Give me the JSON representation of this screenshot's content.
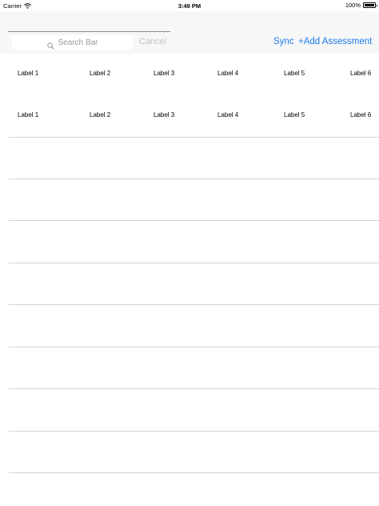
{
  "status_bar": {
    "carrier": "Carrier",
    "time": "3:49 PM",
    "battery": "100%"
  },
  "toolbar": {
    "search_placeholder": "Search Bar",
    "cancel_label": "Cancel",
    "sync_label": "Sync",
    "add_label": "+Add Assessment"
  },
  "table": {
    "rows": [
      {
        "labels": [
          "Label 1",
          "Label 2",
          "Label 3",
          "Label 4",
          "Label 5",
          "Label 6"
        ]
      },
      {
        "labels": [
          "Label 1",
          "Label 2",
          "Label 3",
          "Label 4",
          "Label 5",
          "Label 6"
        ]
      }
    ]
  },
  "colors": {
    "accent": "#1b7bea",
    "separator": "#d4d4d4",
    "toolbar_bg": "#f7f7f7",
    "disabled_text": "#c4c4c4"
  },
  "icons": {
    "wifi": "wifi-icon",
    "battery": "battery-icon",
    "search": "search-icon"
  }
}
